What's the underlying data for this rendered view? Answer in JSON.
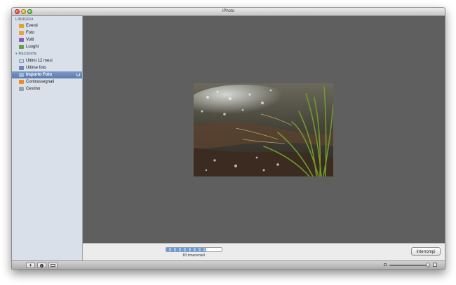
{
  "window": {
    "title": "iPhoto"
  },
  "sidebar": {
    "library_header": "LIBRERIA",
    "library_items": [
      {
        "label": "Eventi",
        "icon": "events-icon",
        "color": "#e3a22a"
      },
      {
        "label": "Foto",
        "icon": "photos-icon",
        "color": "#e8a53b"
      },
      {
        "label": "Volti",
        "icon": "faces-icon",
        "color": "#8a5cb2"
      },
      {
        "label": "Luoghi",
        "icon": "places-icon",
        "color": "#6aa04a"
      }
    ],
    "recent_header": "RECENTE",
    "recent_items": [
      {
        "label": "Ultimi 12 mesi",
        "icon": "calendar-icon",
        "color": "#c9d4e4"
      },
      {
        "label": "Ultime foto",
        "icon": "last-import-icon",
        "color": "#6b86b5"
      },
      {
        "label": "Importo Foto",
        "icon": "import-icon",
        "color": "#a0b8da",
        "selected": true
      },
      {
        "label": "Contrassegnati",
        "icon": "flag-icon",
        "color": "#f08a1c"
      },
      {
        "label": "Cestino",
        "icon": "trash-icon",
        "color": "#9aa0a8"
      }
    ]
  },
  "import": {
    "progress_fraction": 0.72,
    "remaining_text": "83 rimanente/i",
    "stop_label": "Interrompi"
  },
  "bottombar": {
    "add_label": "+",
    "info_label": "i",
    "zoom_fraction": 0.95
  },
  "colors": {
    "main_background": "#5f5f5f",
    "sidebar_background": "#d9e0ea",
    "selection": "#5a7cb0"
  }
}
